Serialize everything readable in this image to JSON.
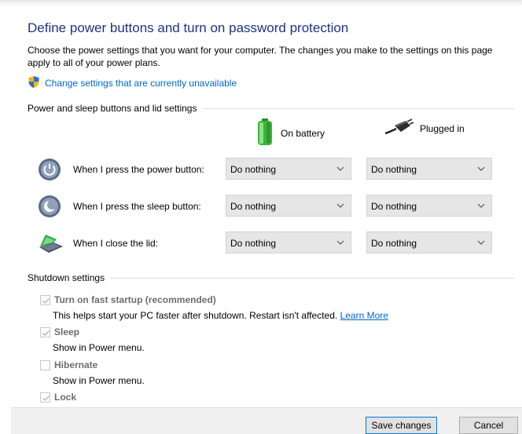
{
  "page": {
    "heading": "Define power buttons and turn on password protection",
    "intro": "Choose the power settings that you want for your computer. The changes you make to the settings on this page apply to all of your power plans.",
    "change_link": "Change settings that are currently unavailable"
  },
  "power_section": {
    "title": "Power and sleep buttons and lid settings",
    "col_battery": "On battery",
    "col_plugged": "Plugged in",
    "rows": [
      {
        "label": "When I press the power button:",
        "battery": "Do nothing",
        "plugged": "Do nothing",
        "icon": "power-button-icon"
      },
      {
        "label": "When I press the sleep button:",
        "battery": "Do nothing",
        "plugged": "Do nothing",
        "icon": "sleep-button-icon"
      },
      {
        "label": "When I close the lid:",
        "battery": "Do nothing",
        "plugged": "Do nothing",
        "icon": "laptop-lid-icon"
      }
    ]
  },
  "shutdown_section": {
    "title": "Shutdown settings",
    "items": [
      {
        "label": "Turn on fast startup (recommended)",
        "checked": true,
        "description": "This helps start your PC faster after shutdown. Restart isn't affected.",
        "link": "Learn More"
      },
      {
        "label": "Sleep",
        "checked": true,
        "description": "Show in Power menu."
      },
      {
        "label": "Hibernate",
        "checked": false,
        "description": "Show in Power menu."
      },
      {
        "label": "Lock",
        "checked": true
      }
    ]
  },
  "footer": {
    "save_label": "Save changes",
    "cancel_label": "Cancel"
  },
  "colors": {
    "heading": "#1e3287",
    "link": "#0066cc",
    "select_bg": "#e6e6e6",
    "primary_border": "#0078d7"
  }
}
